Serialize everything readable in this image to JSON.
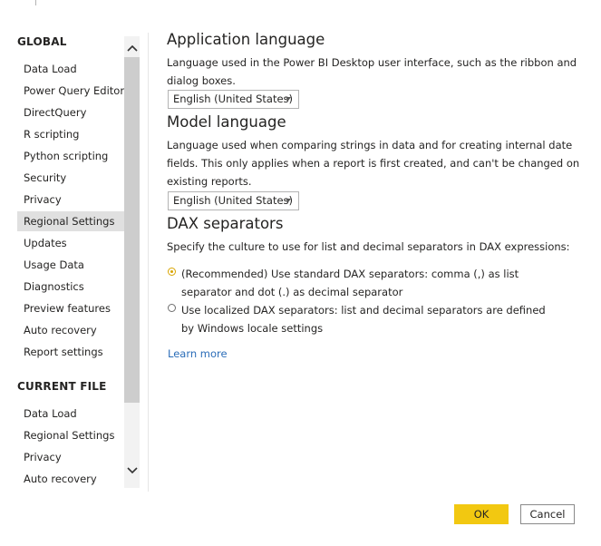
{
  "sidebar": {
    "global_header": "GLOBAL",
    "global_items": [
      {
        "label": "Data Load"
      },
      {
        "label": "Power Query Editor"
      },
      {
        "label": "DirectQuery"
      },
      {
        "label": "R scripting"
      },
      {
        "label": "Python scripting"
      },
      {
        "label": "Security"
      },
      {
        "label": "Privacy"
      },
      {
        "label": "Regional Settings",
        "selected": true
      },
      {
        "label": "Updates"
      },
      {
        "label": "Usage Data"
      },
      {
        "label": "Diagnostics"
      },
      {
        "label": "Preview features"
      },
      {
        "label": "Auto recovery"
      },
      {
        "label": "Report settings"
      }
    ],
    "current_header": "CURRENT FILE",
    "current_items": [
      {
        "label": "Data Load"
      },
      {
        "label": "Regional Settings"
      },
      {
        "label": "Privacy"
      },
      {
        "label": "Auto recovery"
      }
    ]
  },
  "main": {
    "app_language": {
      "title": "Application language",
      "description": "Language used in the Power BI Desktop user interface, such as the ribbon and dialog boxes.",
      "value": "English (United States)"
    },
    "model_language": {
      "title": "Model language",
      "description": "Language used when comparing strings in data and for creating internal date fields. This only applies when a report is first created, and can't be changed on existing reports.",
      "value": "English (United States)"
    },
    "dax": {
      "title": "DAX separators",
      "description": "Specify the culture to use for list and decimal separators in DAX expressions:",
      "option_recommended": "(Recommended) Use standard DAX separators: comma (,) as list separator and dot (.) as decimal separator",
      "option_localized": "Use localized DAX separators: list and decimal separators are defined by Windows locale settings",
      "selected": "recommended"
    },
    "learn_more": "Learn more"
  },
  "footer": {
    "ok_label": "OK",
    "cancel_label": "Cancel"
  },
  "colors": {
    "accent": "#f2c811",
    "link": "#2b6db8",
    "selected_bg": "#e0e0e0"
  }
}
